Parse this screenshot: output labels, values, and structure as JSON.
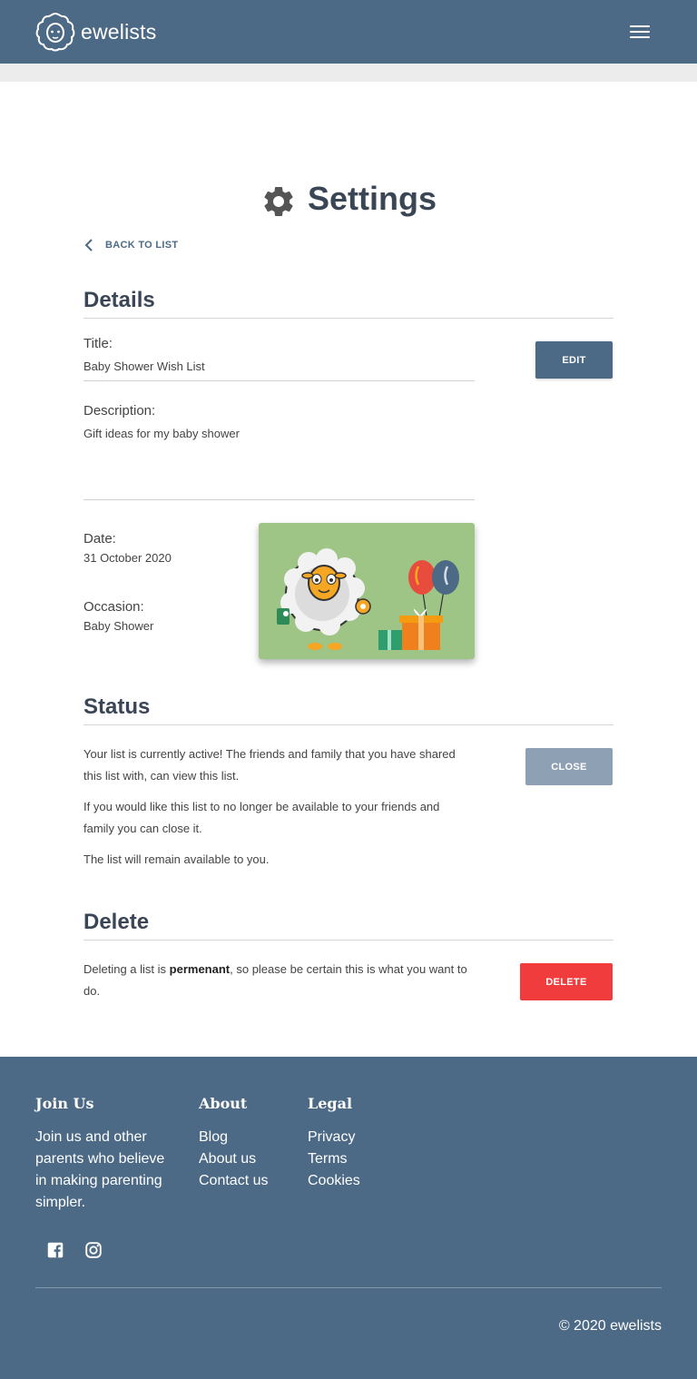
{
  "brand": {
    "name": "ewelists"
  },
  "page": {
    "title": "Settings",
    "back_label": "BACK TO LIST"
  },
  "details": {
    "heading": "Details",
    "title_label": "Title:",
    "title_value": "Baby Shower Wish List",
    "description_label": "Description:",
    "description_value": "Gift ideas for my baby shower",
    "date_label": "Date:",
    "date_value": "31 October 2020",
    "occasion_label": "Occasion:",
    "occasion_value": "Baby Shower",
    "edit_label": "EDIT"
  },
  "status": {
    "heading": "Status",
    "para1": "Your list is currently active! The friends and family that you have shared this list with, can view this list.",
    "para2": "If you would like this list to no longer be available to your friends and family you can close it.",
    "para3": "The list will remain available to you.",
    "close_label": "CLOSE"
  },
  "delete": {
    "heading": "Delete",
    "para_before": "Deleting a list is ",
    "para_bold": "permenant",
    "para_after": ", so please be certain this is what you want to do.",
    "delete_label": "DELETE"
  },
  "footer": {
    "join_heading": "Join Us",
    "join_text": "Join us and other parents who believe in making parenting simpler.",
    "about_heading": "About",
    "about_links": [
      "Blog",
      "About us",
      "Contact us"
    ],
    "legal_heading": "Legal",
    "legal_links": [
      "Privacy",
      "Terms",
      "Cookies"
    ],
    "social_icons": [
      "facebook-icon",
      "instagram-icon"
    ],
    "copyright": "© 2020 ewelists"
  },
  "colors": {
    "header": "#4c6a85",
    "heading_text": "#3a4556",
    "edit_button": "#4c6a85",
    "close_button": "#8da0b4",
    "delete_button": "#f03c3c",
    "image_background": "#9fc586"
  }
}
